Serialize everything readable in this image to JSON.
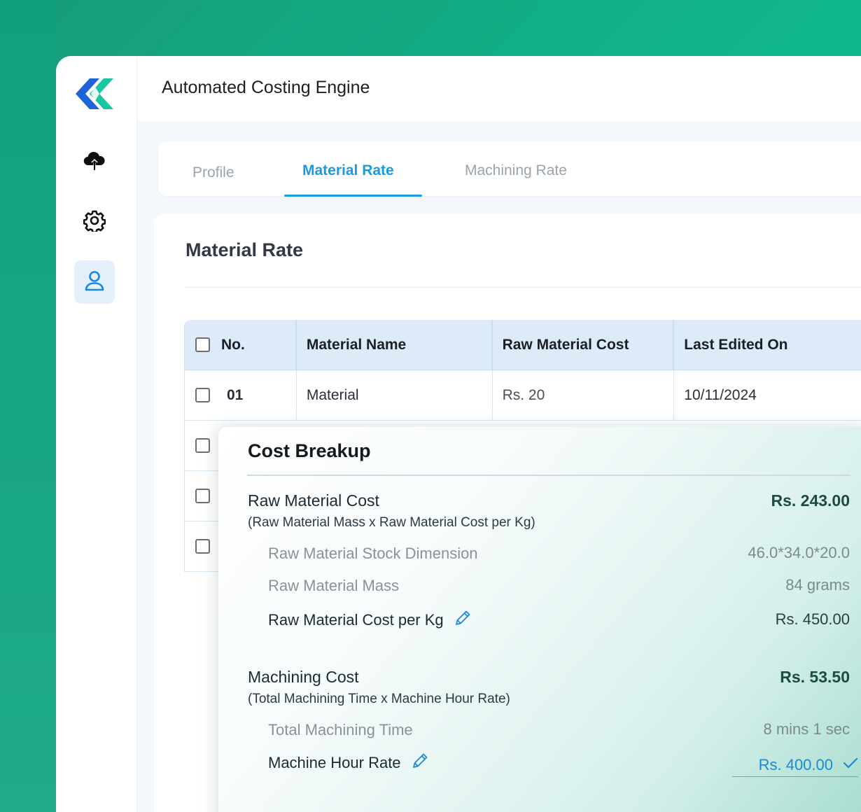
{
  "app": {
    "title": "Automated Costing Engine"
  },
  "sidebar": {
    "items": [
      {
        "name": "upload",
        "icon": "cloud-upload-icon"
      },
      {
        "name": "settings",
        "icon": "gear-icon"
      },
      {
        "name": "profile",
        "icon": "user-icon",
        "active": true
      }
    ]
  },
  "tabs": [
    {
      "label": "Profile",
      "active": false
    },
    {
      "label": "Material Rate",
      "active": true
    },
    {
      "label": "Machining Rate",
      "active": false
    }
  ],
  "main": {
    "section_title": "Material Rate",
    "table": {
      "headers": [
        "No.",
        "Material Name",
        "Raw Material Cost",
        "Last Edited On"
      ],
      "rows": [
        {
          "no": "01",
          "name": "Material",
          "cost": "Rs. 20",
          "date": "10/11/2024"
        }
      ]
    }
  },
  "cost_breakup": {
    "title": "Cost Breakup",
    "raw_material": {
      "heading": "Raw Material Cost",
      "formula": "(Raw Material Mass x Raw Material Cost per Kg)",
      "total": "Rs. 243.00",
      "items": [
        {
          "label": "Raw Material Stock Dimension",
          "value": "46.0*34.0*20.0"
        },
        {
          "label": "Raw Material Mass",
          "value": "84 grams"
        },
        {
          "label": "Raw Material Cost per Kg",
          "value": "Rs. 450.00",
          "editable": true
        }
      ]
    },
    "machining": {
      "heading": "Machining Cost",
      "formula": "(Total Machining Time x Machine Hour Rate)",
      "total": "Rs. 53.50",
      "items": [
        {
          "label": "Total Machining Time",
          "value": "8 mins 1 sec"
        },
        {
          "label": "Machine Hour Rate",
          "value": "Rs. 400.00",
          "editable": true,
          "editing": true
        }
      ]
    }
  },
  "colors": {
    "accent": "#1a9be0",
    "brand_green": "#11b48a",
    "brand_blue": "#1a6fd6",
    "table_header_bg": "#dcebf7"
  }
}
